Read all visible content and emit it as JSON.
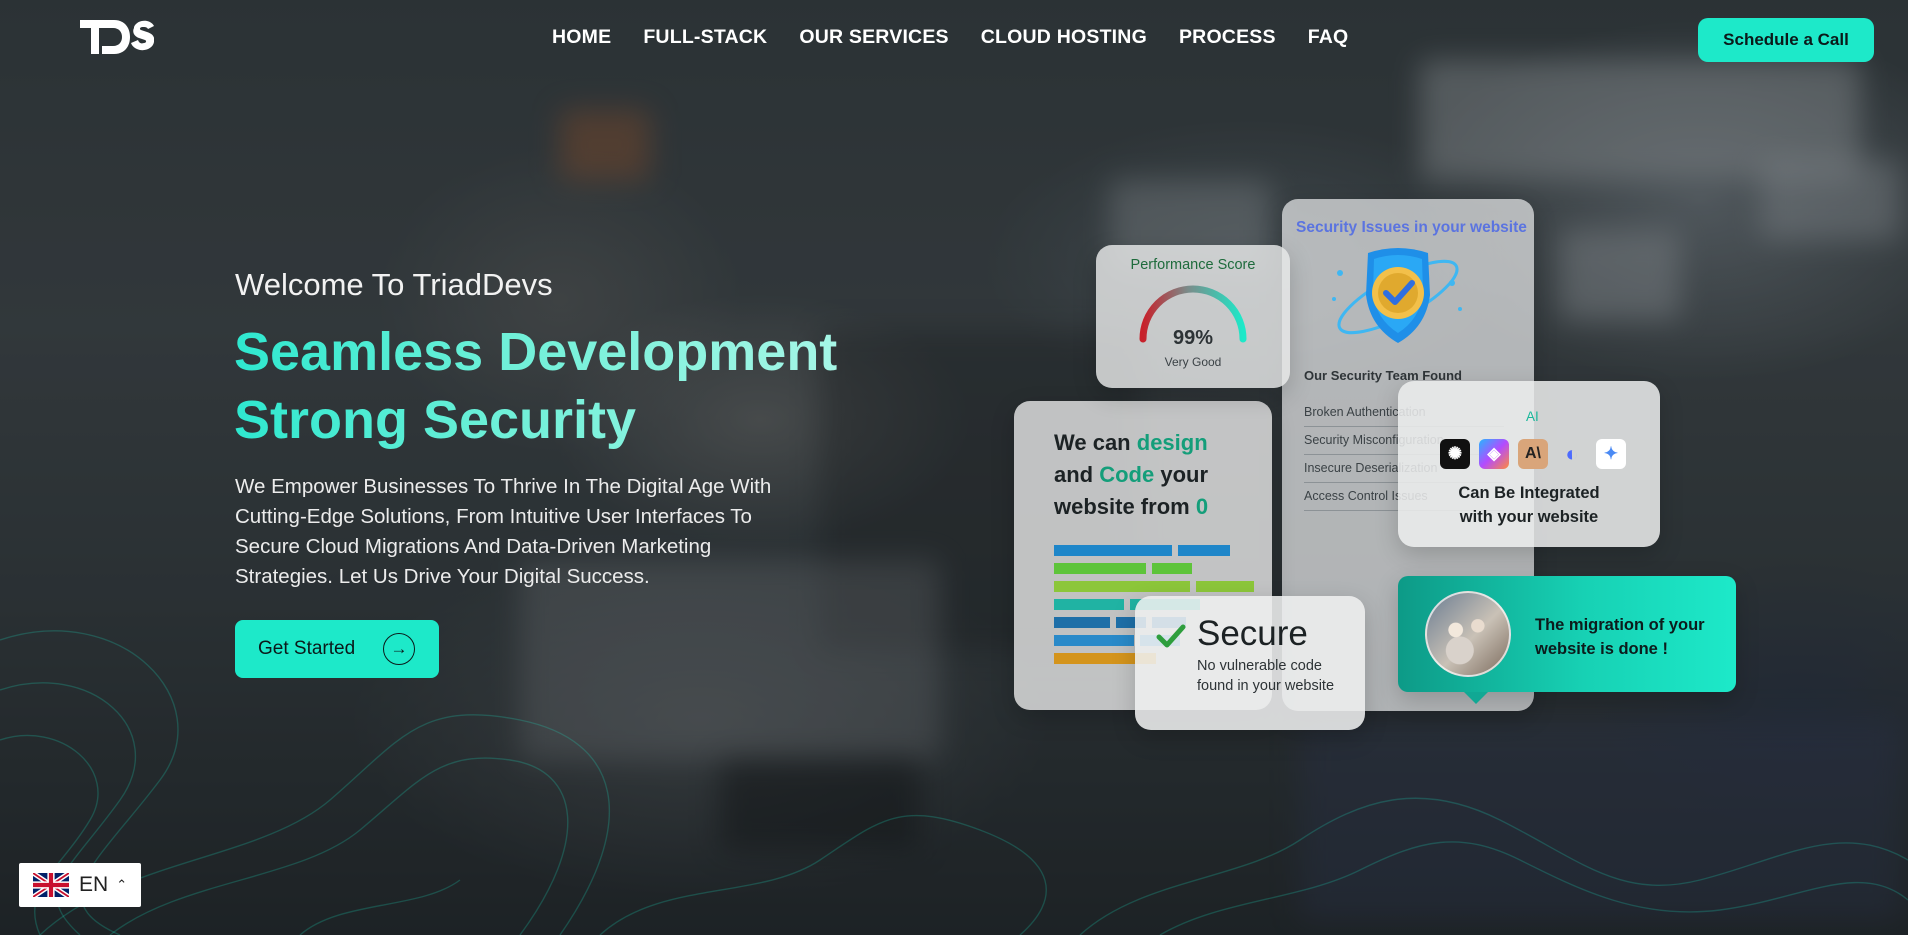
{
  "brand": {
    "logo_text": "TDS"
  },
  "nav": {
    "items": [
      "HOME",
      "FULL-STACK",
      "OUR SERVICES",
      "CLOUD HOSTING",
      "PROCESS",
      "FAQ"
    ]
  },
  "header": {
    "cta_label": "Schedule a Call"
  },
  "hero": {
    "welcome": "Welcome To TriadDevs",
    "title_line1": "Seamless Development",
    "title_line2": "Strong Security",
    "description": "We Empower Businesses To Thrive In The Digital Age With Cutting-Edge Solutions, From Intuitive User Interfaces To Secure Cloud Migrations And Data-Driven Marketing Strategies. Let Us Drive Your Digital Success.",
    "cta_label": "Get Started"
  },
  "cards": {
    "performance": {
      "title": "Performance Score",
      "score": "99%",
      "label": "Very Good",
      "score_value": 99
    },
    "security": {
      "title": "Security Issues in your website",
      "found_label": "Our Security Team Found",
      "issues": [
        "Broken Authentication",
        "Security Misconfiguration",
        "Insecure Deserialization",
        "Access Control Issues"
      ]
    },
    "code": {
      "line1_a": "We can ",
      "line1_b": "design",
      "line2_a": "and ",
      "line2_b": "Code",
      "line2_c": " your",
      "line3_a": "website from ",
      "line3_b": "0"
    },
    "ai": {
      "label": "AI",
      "text_line1": "Can Be Integrated",
      "text_line2": "with your website"
    },
    "secure": {
      "title": "Secure",
      "description": "No vulnerable code found in your website"
    },
    "migration": {
      "text": "The migration of your website is done !"
    }
  },
  "language": {
    "code": "EN"
  },
  "colors": {
    "accent": "#1de9c9",
    "accent_dark": "#0d9a87",
    "security_title": "#5b74e0"
  }
}
